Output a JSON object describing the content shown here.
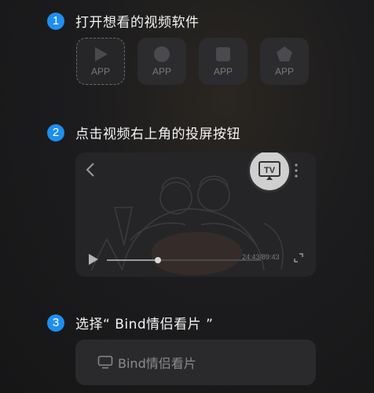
{
  "steps": [
    {
      "number": "1",
      "title": "打开想看的视频软件"
    },
    {
      "number": "2",
      "title": "点击视频右上角的投屏按钮"
    },
    {
      "number": "3",
      "title": "选择“ Bind情侣看片 ”"
    }
  ],
  "apps": [
    {
      "label": "APP",
      "icon": "play-icon"
    },
    {
      "label": "APP",
      "icon": "circle-icon"
    },
    {
      "label": "APP",
      "icon": "square-icon"
    },
    {
      "label": "APP",
      "icon": "pentagon-icon"
    }
  ],
  "player": {
    "cast_icon": "tv-cast-icon",
    "time": "24:43/89:43",
    "progress": 0.33
  },
  "bind_button": {
    "label": "Bind情侣看片",
    "icon": "monitor-icon"
  },
  "colors": {
    "accent": "#1e8ff0",
    "background": "#1c1c1e",
    "card": "#2c2c2e"
  }
}
